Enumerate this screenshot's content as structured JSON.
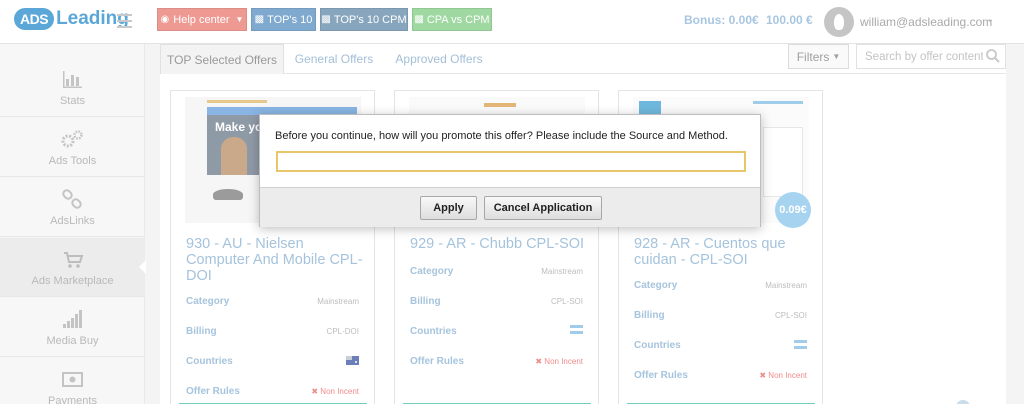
{
  "brand": {
    "badge": "ADS",
    "name": "Leading"
  },
  "header": {
    "buttons": [
      {
        "label": "Help center",
        "color": "#ee9a93"
      },
      {
        "label": "TOP's 10",
        "color": "#7fa9cf"
      },
      {
        "label": "TOP's 10 CPM",
        "color": "#87a5bd"
      },
      {
        "label": "CPA vs CPM",
        "color": "#9fd8a0"
      }
    ],
    "bonus": "Bonus: 0.00€",
    "balance": "100.00 €",
    "user_email": "william@adsleading.com"
  },
  "sidebar": {
    "items": [
      {
        "label": "Stats",
        "icon": "bar-chart-icon",
        "active": false
      },
      {
        "label": "Ads Tools",
        "icon": "gears-icon",
        "active": false
      },
      {
        "label": "AdsLinks",
        "icon": "link-icon",
        "active": false
      },
      {
        "label": "Ads Marketplace",
        "icon": "cart-icon",
        "active": true
      },
      {
        "label": "Media Buy",
        "icon": "signal-bars-icon",
        "active": false
      },
      {
        "label": "Payments",
        "icon": "money-icon",
        "active": false
      }
    ]
  },
  "tabs": [
    {
      "label": "TOP Selected Offers",
      "active": true
    },
    {
      "label": "General Offers",
      "active": false
    },
    {
      "label": "Approved Offers",
      "active": false
    }
  ],
  "toolbar": {
    "filters_label": "Filters",
    "search_placeholder": "Search by offer content"
  },
  "row_labels": {
    "category": "Category",
    "billing": "Billing",
    "countries": "Countries",
    "rules": "Offer Rules"
  },
  "offers": [
    {
      "title": "930 - AU - Nielsen Computer And Mobile CPL-DOI",
      "category": "Mainstream",
      "billing": "CPL-DOI",
      "rules": "Non Incent",
      "image_caption": "Make your"
    },
    {
      "title": "929 - AR - Chubb CPL-SOI",
      "category": "Mainstream",
      "billing": "CPL-SOI",
      "rules": "Non Incent"
    },
    {
      "title": "928 - AR - Cuentos que cuidan - CPL-SOI",
      "category": "Mainstream",
      "billing": "CPL-SOI",
      "rules": "Non Incent",
      "price": "0.09€"
    }
  ],
  "modal": {
    "message": "Before you continue, how will you promote this offer? Please include the Source and Method.",
    "input_value": "",
    "apply_label": "Apply",
    "cancel_label": "Cancel Application"
  }
}
